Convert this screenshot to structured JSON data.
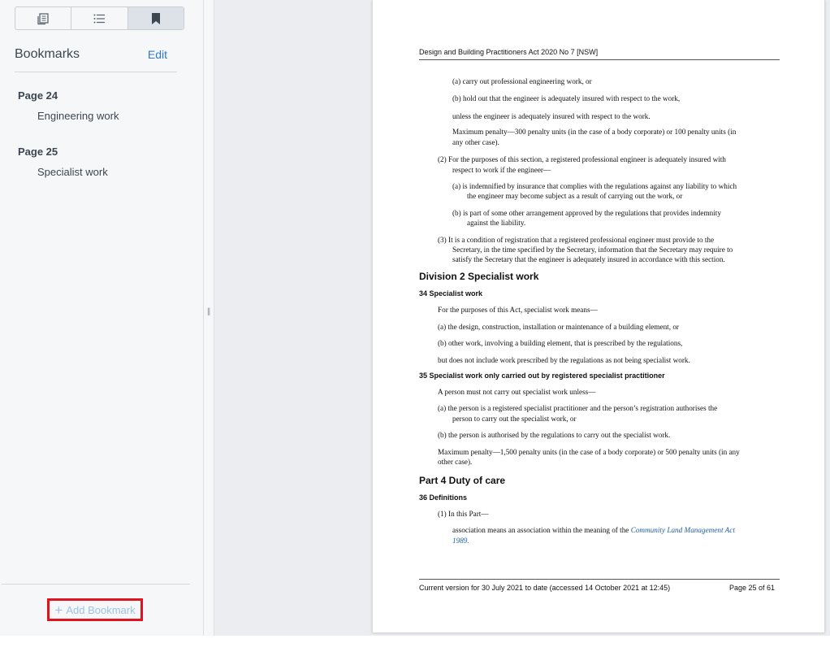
{
  "sidebar": {
    "tabs": [
      {
        "name": "thumbnails",
        "icon": "thumbnails-icon"
      },
      {
        "name": "outline",
        "icon": "list-icon"
      },
      {
        "name": "bookmarks",
        "icon": "bookmark-icon",
        "active": true
      }
    ],
    "bookmarks_title": "Bookmarks",
    "edit_label": "Edit",
    "bookmarks": [
      {
        "page": "Page 24",
        "label": "Engineering work"
      },
      {
        "page": "Page 25",
        "label": "Specialist work"
      }
    ],
    "add_bookmark_label": "Add Bookmark",
    "highlight_color": "#e0141e",
    "accent_color": "#3178c6"
  },
  "document": {
    "header": "Design and Building Practitioners Act 2020 No 7 [NSW]",
    "lines": [
      {
        "t": "(a)  carry out professional engineering work, or"
      },
      {
        "t": "(b)  hold out that the engineer is adequately insured with respect to the work,"
      },
      {
        "t": "unless the engineer is adequately insured with respect to the work."
      },
      {
        "t": "Maximum penalty—300 penalty units (in the case of a body corporate) or 100 penalty units (in"
      },
      {
        "t": "any other case)."
      },
      {
        "t": "(2)  For the purposes of this section, a registered professional engineer is adequately insured with"
      },
      {
        "t": "respect to work if the engineer—"
      },
      {
        "t": "(a)  is indemnified by insurance that complies with the regulations against any liability to which"
      },
      {
        "t": "the engineer may become subject as a result of carrying out the work, or"
      },
      {
        "t": "(b)  is part of some other arrangement approved by the regulations that provides indemnity"
      },
      {
        "t": "against the liability."
      },
      {
        "t": "(3)  It is a condition of registration that a registered professional engineer must provide to the"
      },
      {
        "t": "Secretary, in the time specified by the Secretary, information that the Secretary may require to"
      },
      {
        "t": "satisfy the Secretary that the engineer is adequately insured in accordance with this section."
      },
      {
        "t": "Division 2 Specialist work"
      },
      {
        "t": "34   Specialist work"
      },
      {
        "t": "For the purposes of this Act, specialist work means—"
      },
      {
        "t": "(a)  the design, construction, installation or maintenance of a building element, or"
      },
      {
        "t": "(b)  other work, involving a building element, that is prescribed by the regulations,"
      },
      {
        "t": "but does not include work prescribed by the regulations as not being specialist work."
      },
      {
        "t": "35   Specialist work only carried out by registered specialist practitioner"
      },
      {
        "t": "A person must not carry out specialist work unless—"
      },
      {
        "t": "(a)  the person is a registered specialist practitioner and the person’s registration authorises the"
      },
      {
        "t": "person to carry out the specialist work, or"
      },
      {
        "t": "(b)  the person is authorised by the regulations to carry out the specialist work."
      },
      {
        "t": "Maximum penalty—1,500 penalty units (in the case of a body corporate) or 500 penalty units (in any"
      },
      {
        "t": "other case)."
      },
      {
        "t": "Part 4 Duty of care"
      },
      {
        "t": "36   Definitions"
      },
      {
        "t": "(1)  In this Part—"
      },
      {
        "t": "association means an association within the meaning of the"
      },
      {
        "t": "Community Land Management Act"
      },
      {
        "t": "1989."
      }
    ],
    "footer_left": "Current version for 30 July 2021 to date (accessed 14 October 2021 at 12:45)",
    "footer_right": "Page 25 of 61"
  }
}
